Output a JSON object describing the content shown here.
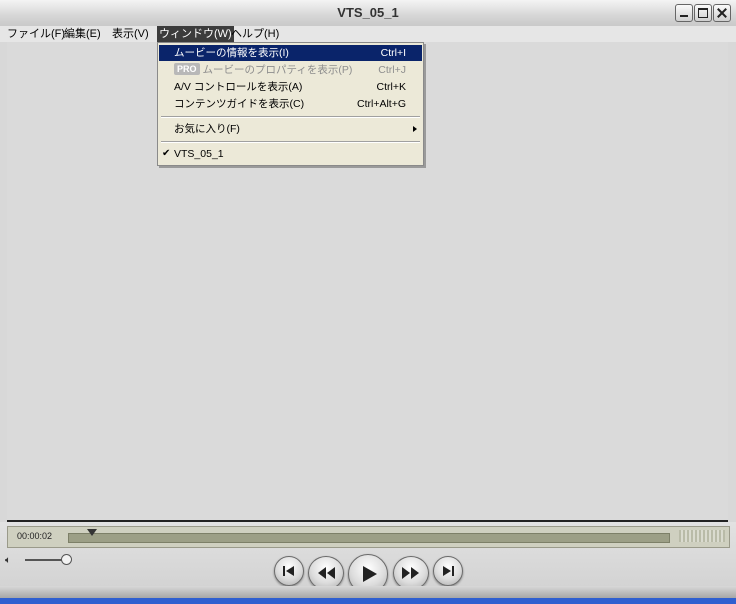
{
  "window": {
    "title": "VTS_05_1"
  },
  "menubar": {
    "items": [
      {
        "label": "ファイル(F)"
      },
      {
        "label": "編集(E)"
      },
      {
        "label": "表示(V)"
      },
      {
        "label": "ウィンドウ(W)",
        "active": true
      },
      {
        "label": "ヘルプ(H)"
      }
    ]
  },
  "dropdown": {
    "items": [
      {
        "label": "ムービーの情報を表示(I)",
        "shortcut": "Ctrl+I",
        "state": "highlighted"
      },
      {
        "badge": "PRO",
        "label": "ムービーのプロパティを表示(P)",
        "shortcut": "Ctrl+J",
        "state": "disabled"
      },
      {
        "label": "A/V コントロールを表示(A)",
        "shortcut": "Ctrl+K"
      },
      {
        "label": "コンテンツガイドを表示(C)",
        "shortcut": "Ctrl+Alt+G"
      },
      {
        "label": "お気に入り(F)",
        "submenu": true
      },
      {
        "label": "VTS_05_1",
        "checked": true
      }
    ]
  },
  "controls": {
    "time": "00:00:02",
    "buttons": [
      {
        "name": "go-to-start-icon"
      },
      {
        "name": "rewind-icon"
      },
      {
        "name": "play-icon"
      },
      {
        "name": "fast-forward-icon"
      },
      {
        "name": "go-to-end-icon"
      }
    ]
  }
}
